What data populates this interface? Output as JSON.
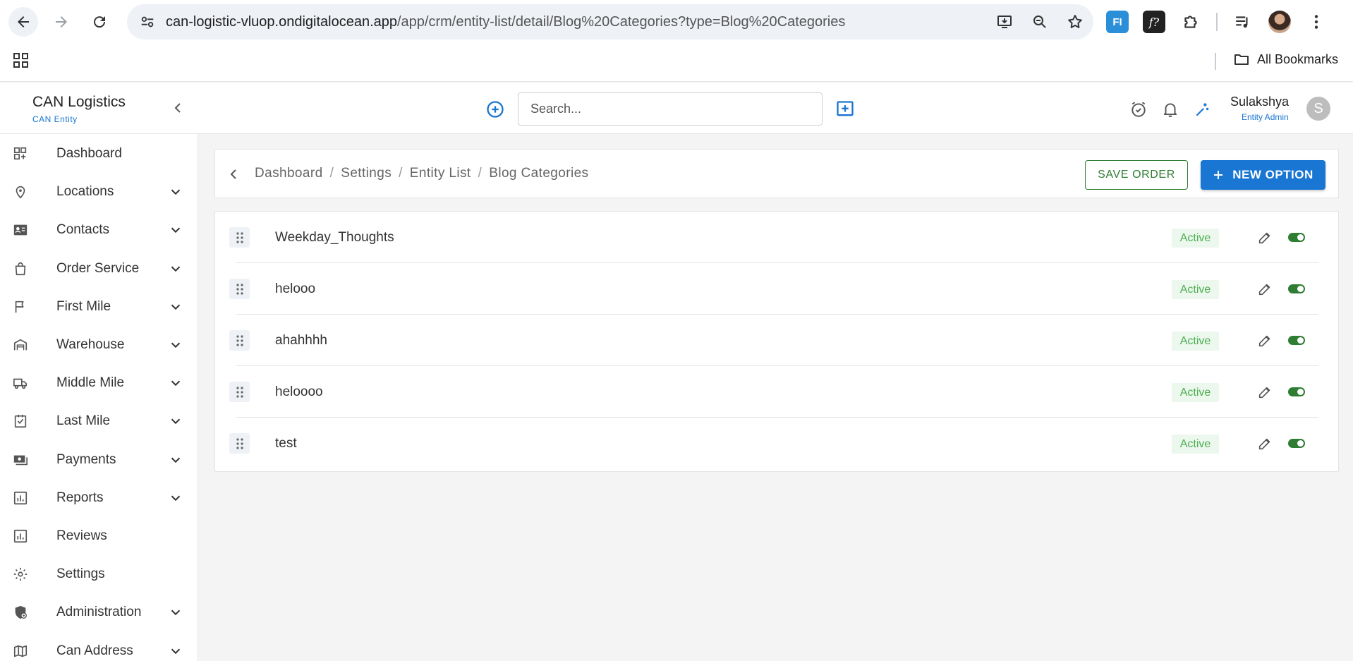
{
  "browser": {
    "url_host": "can-logistic-vluop.ondigitalocean.app",
    "url_path": "/app/crm/entity-list/detail/Blog%20Categories?type=Blog%20Categories",
    "ext_fi_label": "FI",
    "ext_fx_label": "f?",
    "all_bookmarks": "All Bookmarks"
  },
  "header": {
    "brand_title": "CAN Logistics",
    "brand_subtitle": "CAN Entity",
    "search_placeholder": "Search...",
    "user_name": "Sulakshya",
    "user_role": "Entity Admin",
    "user_initial": "S"
  },
  "sidebar": {
    "items": [
      {
        "label": "Dashboard",
        "icon": "dashboard-icon",
        "has_children": false
      },
      {
        "label": "Locations",
        "icon": "location-pin-icon",
        "has_children": true
      },
      {
        "label": "Contacts",
        "icon": "contact-card-icon",
        "has_children": true
      },
      {
        "label": "Order Service",
        "icon": "shopping-bag-icon",
        "has_children": true
      },
      {
        "label": "First Mile",
        "icon": "flag-icon",
        "has_children": true
      },
      {
        "label": "Warehouse",
        "icon": "warehouse-icon",
        "has_children": true
      },
      {
        "label": "Middle Mile",
        "icon": "truck-icon",
        "has_children": true
      },
      {
        "label": "Last Mile",
        "icon": "checklist-icon",
        "has_children": true
      },
      {
        "label": "Payments",
        "icon": "payments-icon",
        "has_children": true
      },
      {
        "label": "Reports",
        "icon": "bar-chart-icon",
        "has_children": true
      },
      {
        "label": "Reviews",
        "icon": "bar-chart-icon",
        "has_children": false
      },
      {
        "label": "Settings",
        "icon": "gear-icon",
        "has_children": false
      },
      {
        "label": "Administration",
        "icon": "admin-shield-icon",
        "has_children": true
      },
      {
        "label": "Can Address",
        "icon": "map-icon",
        "has_children": true
      }
    ]
  },
  "breadcrumb": {
    "items": [
      "Dashboard",
      "Settings",
      "Entity List",
      "Blog Categories"
    ],
    "separator": "/"
  },
  "actions": {
    "save_order": "SAVE ORDER",
    "new_option": "NEW OPTION"
  },
  "list": {
    "rows": [
      {
        "label": "Weekday_Thoughts",
        "status": "Active",
        "enabled": true
      },
      {
        "label": "helooo",
        "status": "Active",
        "enabled": true
      },
      {
        "label": "ahahhhh",
        "status": "Active",
        "enabled": true
      },
      {
        "label": "heloooo",
        "status": "Active",
        "enabled": true
      },
      {
        "label": "test",
        "status": "Active",
        "enabled": true
      }
    ]
  },
  "colors": {
    "primary": "#1976d2",
    "success": "#2e7d32",
    "badge_text": "#4caf50",
    "badge_bg": "#ecf7ee"
  }
}
